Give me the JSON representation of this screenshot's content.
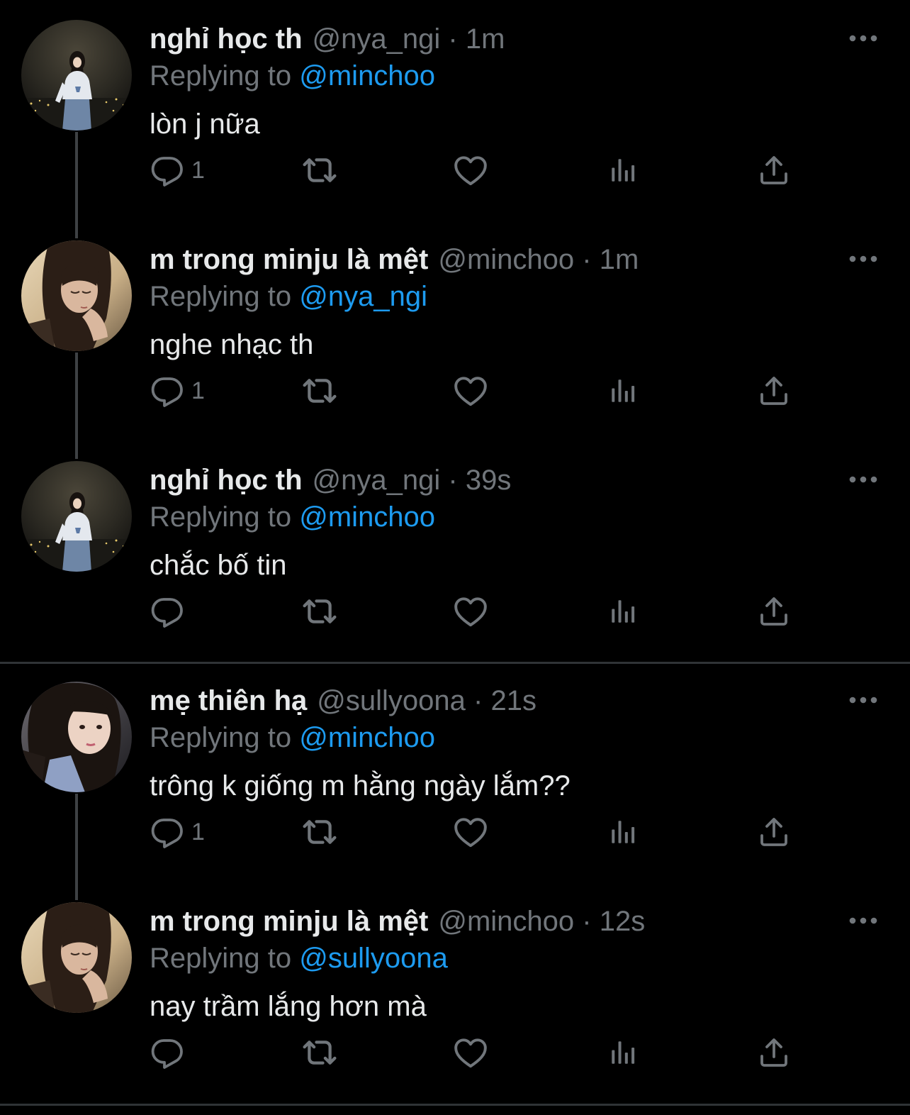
{
  "colors": {
    "background": "#000000",
    "text_primary": "#e7e9ea",
    "text_secondary": "#71767b",
    "mention": "#1d9bf0",
    "thread_line": "#3e4144",
    "divider": "#2f3336"
  },
  "tweets": [
    {
      "display_name": "nghỉ học th",
      "handle": "@nya_ngi",
      "separator": "·",
      "time": "1m",
      "replying_label": "Replying to",
      "replying_to": "@minchoo",
      "text": "lòn j nữa",
      "reply_count": "1",
      "icons": [
        "reply-icon",
        "retweet-icon",
        "like-icon",
        "analytics-icon",
        "share-icon",
        "more-icon"
      ]
    },
    {
      "display_name": "m trong minju là mệt",
      "handle": "@minchoo",
      "separator": "·",
      "time": "1m",
      "replying_label": "Replying to",
      "replying_to": "@nya_ngi",
      "text": "nghe nhạc th",
      "reply_count": "1",
      "icons": [
        "reply-icon",
        "retweet-icon",
        "like-icon",
        "analytics-icon",
        "share-icon",
        "more-icon"
      ]
    },
    {
      "display_name": "nghỉ học th",
      "handle": "@nya_ngi",
      "separator": "·",
      "time": "39s",
      "replying_label": "Replying to",
      "replying_to": "@minchoo",
      "text": "chắc bố tin",
      "reply_count": "",
      "icons": [
        "reply-icon",
        "retweet-icon",
        "like-icon",
        "analytics-icon",
        "share-icon",
        "more-icon"
      ]
    },
    {
      "display_name": "mẹ thiên hạ",
      "handle": "@sullyoona",
      "separator": "·",
      "time": "21s",
      "replying_label": "Replying to",
      "replying_to": "@minchoo",
      "text": "trông k giống m hằng ngày lắm??",
      "reply_count": "1",
      "icons": [
        "reply-icon",
        "retweet-icon",
        "like-icon",
        "analytics-icon",
        "share-icon",
        "more-icon"
      ]
    },
    {
      "display_name": "m trong minju là mệt",
      "handle": "@minchoo",
      "separator": "·",
      "time": "12s",
      "replying_label": "Replying to",
      "replying_to": "@sullyoona",
      "text": "nay trầm lắng hơn mà",
      "reply_count": "",
      "icons": [
        "reply-icon",
        "retweet-icon",
        "like-icon",
        "analytics-icon",
        "share-icon",
        "more-icon"
      ]
    }
  ]
}
